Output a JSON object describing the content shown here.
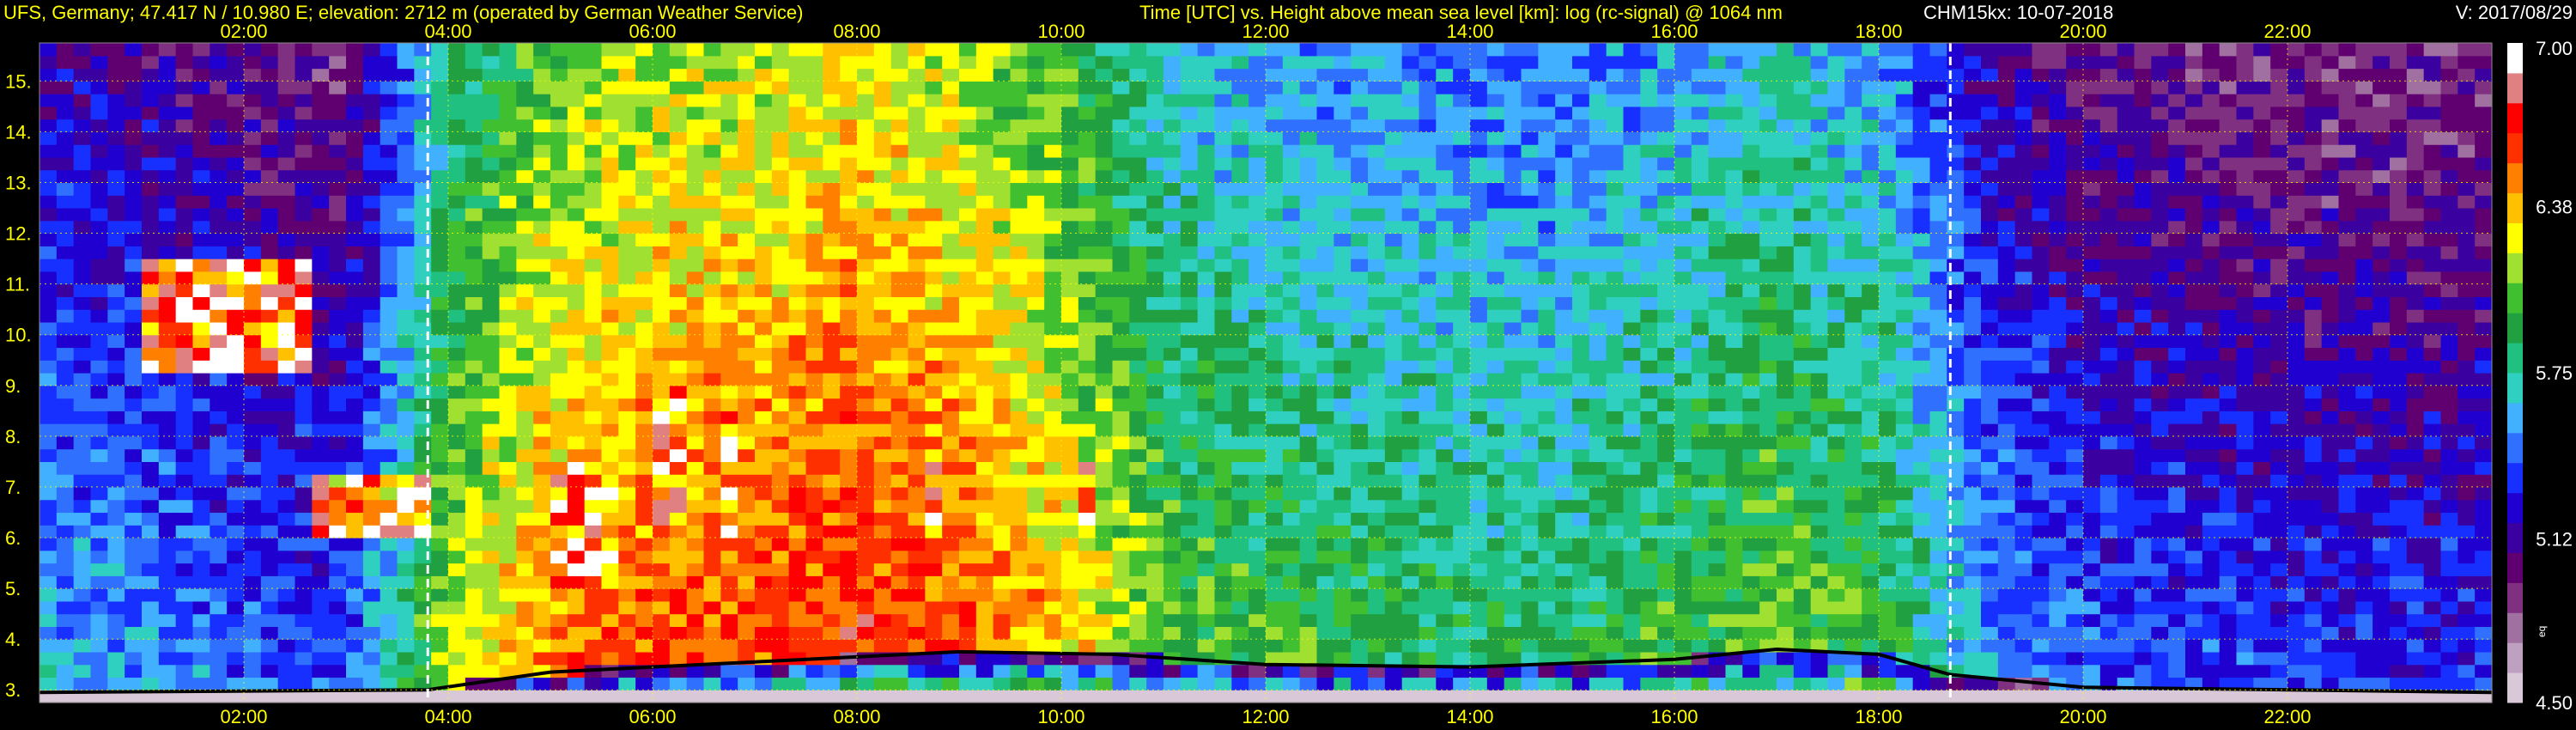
{
  "header": {
    "station": "UFS, Germany; 47.417 N / 10.980 E; elevation: 2712 m  (operated by German Weather Service)",
    "plot_title": "Time [UTC] vs. Height above mean sea level [km]: log (rc-signal) @ 1064 nm",
    "instrument_date": "CHM15kx: 10-07-2018",
    "version": "V: 2017/08/29"
  },
  "chart_data": {
    "type": "heatmap",
    "title": "Time [UTC] vs. Height above mean sea level [km]: log (rc-signal) @ 1064 nm",
    "xlabel": "Time [UTC]",
    "ylabel": "Height above mean sea level [km]",
    "xlim_hours": [
      0,
      24
    ],
    "ylim_km": [
      2.75,
      15.75
    ],
    "x_ticks": [
      "02:00",
      "04:00",
      "06:00",
      "08:00",
      "10:00",
      "12:00",
      "14:00",
      "16:00",
      "18:00",
      "20:00",
      "22:00"
    ],
    "y_ticks": [
      "3.",
      "4.",
      "5.",
      "6.",
      "7.",
      "8.",
      "9.",
      "10.",
      "11.",
      "12.",
      "13.",
      "14.",
      "15."
    ],
    "grid": true,
    "grid_color": "#ffff00",
    "colorbar": {
      "min": 4.5,
      "max": 7.0,
      "tick_labels": [
        "7.00",
        "6.38",
        "5.75",
        "5.12",
        "4.50"
      ],
      "tick_values": [
        7.0,
        6.38,
        5.75,
        5.12,
        4.5
      ],
      "annotation": "eq",
      "colors": [
        "#d8c8d8",
        "#c0a0c0",
        "#a070a0",
        "#803080",
        "#600070",
        "#3a00a0",
        "#2000d0",
        "#1830ff",
        "#3070ff",
        "#40b0ff",
        "#30d0c0",
        "#20c080",
        "#20a040",
        "#40c030",
        "#a0e030",
        "#ffff00",
        "#ffc000",
        "#ff8000",
        "#ff3000",
        "#ff0000",
        "#e08080",
        "#ffffff"
      ]
    },
    "reference_lines_hours": [
      3.8,
      18.7
    ],
    "boundary_layer_top_km": [
      [
        0.0,
        2.95
      ],
      [
        3.8,
        3.0
      ],
      [
        5.0,
        3.35
      ],
      [
        7.0,
        3.55
      ],
      [
        9.0,
        3.75
      ],
      [
        10.5,
        3.7
      ],
      [
        12.0,
        3.5
      ],
      [
        14.0,
        3.45
      ],
      [
        16.0,
        3.6
      ],
      [
        17.0,
        3.8
      ],
      [
        18.0,
        3.7
      ],
      [
        18.7,
        3.3
      ],
      [
        20.0,
        3.05
      ],
      [
        24.0,
        2.95
      ]
    ],
    "cloud_layers": [
      {
        "start_h": 1.0,
        "end_h": 2.7,
        "base_km": 9.2,
        "top_km": 11.5
      },
      {
        "start_h": 2.7,
        "end_h": 3.8,
        "base_km": 6.0,
        "top_km": 7.2
      },
      {
        "start_h": 5.0,
        "end_h": 5.6,
        "base_km": 5.0,
        "top_km": 7.4
      },
      {
        "start_h": 6.0,
        "end_h": 6.3,
        "base_km": 6.3,
        "top_km": 9.0
      },
      {
        "start_h": 6.6,
        "end_h": 6.9,
        "base_km": 6.0,
        "top_km": 8.6
      },
      {
        "start_h": 8.7,
        "end_h": 8.9,
        "base_km": 6.0,
        "top_km": 7.5
      },
      {
        "start_h": 10.2,
        "end_h": 10.35,
        "base_km": 6.0,
        "top_km": 7.5
      }
    ],
    "signal_by_hour": [
      5.6,
      5.55,
      5.45,
      5.4,
      6.2,
      6.5,
      6.6,
      6.6,
      6.7,
      6.6,
      6.4,
      6.1,
      6.0,
      5.95,
      5.9,
      5.9,
      6.0,
      6.1,
      6.0,
      5.6,
      5.45,
      5.4,
      5.35,
      5.35
    ]
  }
}
